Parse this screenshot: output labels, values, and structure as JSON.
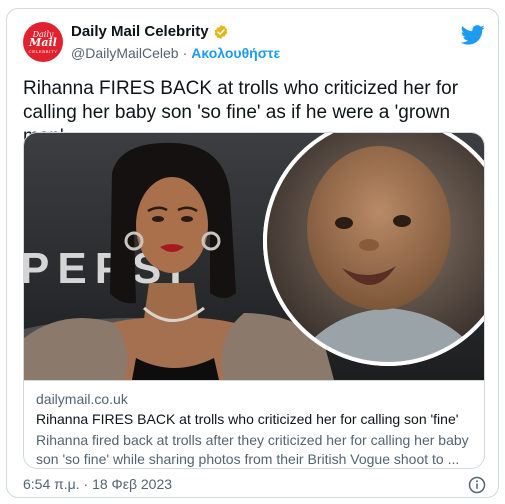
{
  "account": {
    "display_name": "Daily Mail Celebrity",
    "handle": "@DailyMailCeleb",
    "separator": "·",
    "follow_label": "Ακολουθήστε",
    "avatar": {
      "line1": "Daily",
      "line2": "Mail",
      "line3": "CELEBRITY"
    }
  },
  "tweet": {
    "text": "Rihanna FIRES BACK at trolls who criticized her for calling her baby son 'so fine' as if he were a 'grown man'",
    "timestamp": "6:54 π.μ. · 18 Φεβ 2023"
  },
  "link_card": {
    "domain": "dailymail.co.uk",
    "title": "Rihanna FIRES BACK at trolls who criticized her for calling son 'fine'",
    "description": "Rihanna fired back at trolls after they criticized her for calling her baby son 'so fine' while sharing photos from their British Vogue shoot to ...",
    "image_backdrop_text": "PEPSI"
  },
  "colors": {
    "brand_red": "#e2212f",
    "link_blue": "#1d9bf0",
    "verified_gold": "#e2b719",
    "muted_text": "#536471"
  },
  "icons": [
    "verified-badge-icon",
    "twitter-bird-icon",
    "info-icon"
  ]
}
